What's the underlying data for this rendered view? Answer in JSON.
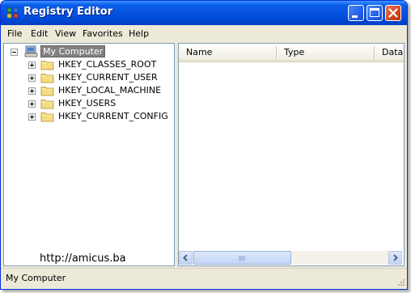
{
  "window": {
    "title": "Registry Editor"
  },
  "colors": {
    "titlebar": "#0553e0",
    "selection": "#808080",
    "pane_border": "#7f9db9",
    "close_button": "#d5461f"
  },
  "menu": [
    "File",
    "Edit",
    "View",
    "Favorites",
    "Help"
  ],
  "tree": {
    "root": "My Computer",
    "nodes": [
      "HKEY_CLASSES_ROOT",
      "HKEY_CURRENT_USER",
      "HKEY_LOCAL_MACHINE",
      "HKEY_USERS",
      "HKEY_CURRENT_CONFIG"
    ]
  },
  "list": {
    "columns": [
      "Name",
      "Type",
      "Data"
    ]
  },
  "watermark": "http://amicus.ba",
  "status": {
    "path": "My Computer"
  },
  "icons": [
    "regedit-icon",
    "minimize-icon",
    "maximize-icon",
    "close-icon",
    "computer-icon",
    "folder-icon",
    "scroll-left-icon",
    "scroll-right-icon",
    "resize-grip-icon"
  ]
}
